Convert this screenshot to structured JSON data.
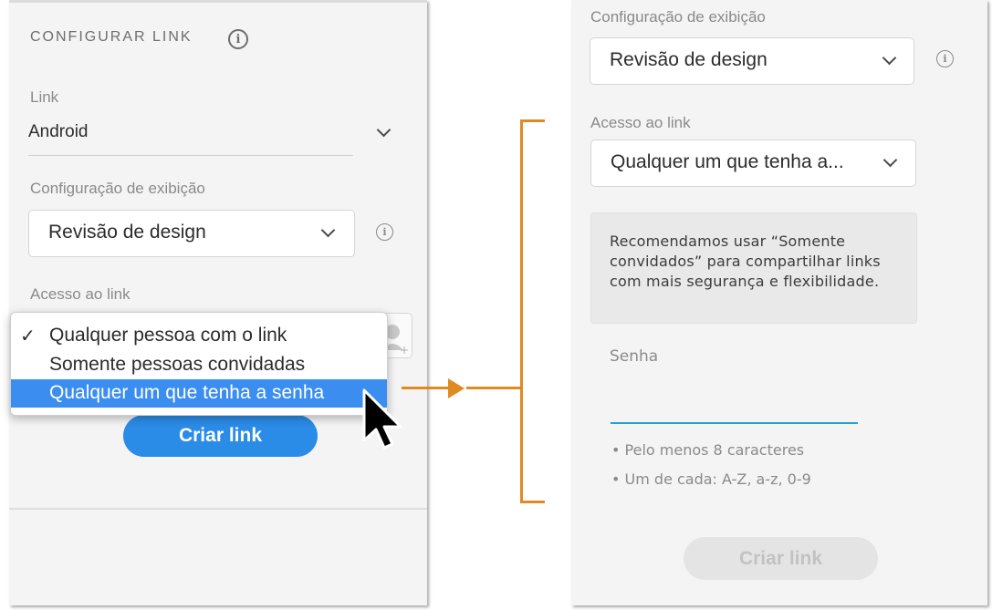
{
  "left": {
    "heading": "CONFIGURAR LINK",
    "info_glyph": "i",
    "link_label": "Link",
    "link_value": "Android",
    "display_label": "Configuração de exibição",
    "display_value": "Revisão de design",
    "access_label": "Acesso ao link",
    "menu": {
      "check_glyph": "✓",
      "items": [
        {
          "label": "Qualquer pessoa com o link",
          "checked": true,
          "highlighted": false
        },
        {
          "label": "Somente pessoas convidadas",
          "checked": false,
          "highlighted": false
        },
        {
          "label": "Qualquer um que tenha a senha",
          "checked": false,
          "highlighted": true
        }
      ]
    },
    "create_button": "Criar link"
  },
  "right": {
    "display_label": "Configuração de exibição",
    "display_value": "Revisão de design",
    "access_label": "Acesso ao link",
    "access_value": "Qualquer um que tenha a...",
    "recommendation": "Recomendamos usar “Somente convidados” para compartilhar links com mais segurança e flexibilidade.",
    "password_label": "Senha",
    "password_value": "",
    "rules": [
      "• Pelo menos 8 caracteres",
      "• Um de cada: A-Z, a-z, 0-9"
    ],
    "create_button": "Criar link"
  },
  "colors": {
    "accent": "#2b8ce8",
    "highlight": "#3b8ef0",
    "connector": "#e08a23",
    "password_underline": "#2a9fd6"
  }
}
